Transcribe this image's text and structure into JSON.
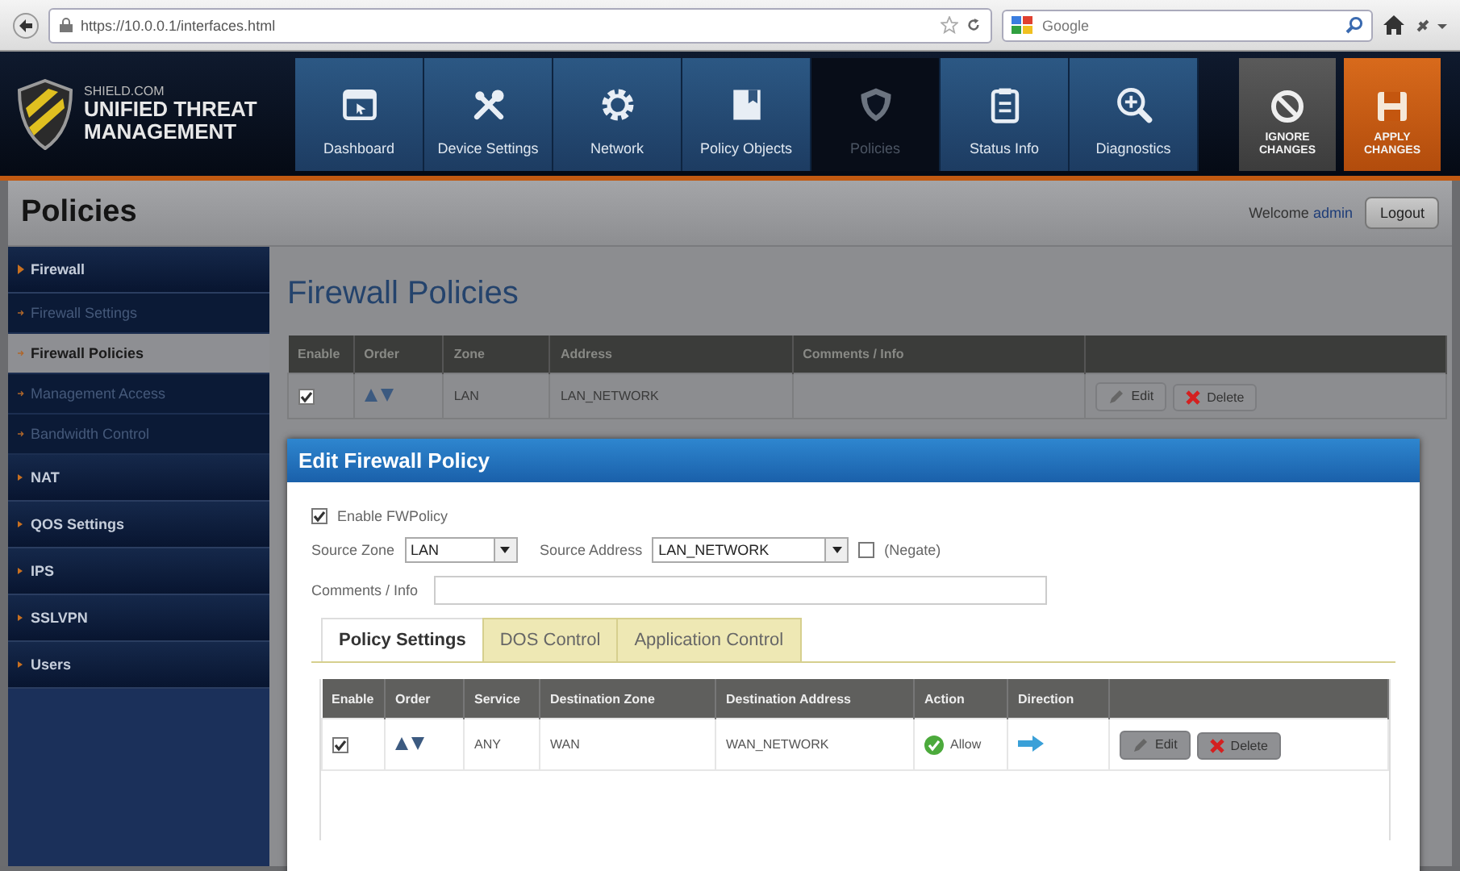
{
  "browser": {
    "url": "https://10.0.0.1/interfaces.html",
    "search": {
      "placeholder": "Google"
    }
  },
  "header": {
    "logo": {
      "top": "SHIELD.COM",
      "title": "UNIFIED THREAT MANAGEMENT"
    },
    "nav": [
      {
        "label": "Dashboard",
        "selected": false
      },
      {
        "label": "Device Settings",
        "selected": false
      },
      {
        "label": "Network",
        "selected": false
      },
      {
        "label": "Policy Objects",
        "selected": false
      },
      {
        "label": "Policies",
        "selected": true
      },
      {
        "label": "Status Info",
        "selected": false
      },
      {
        "label": "Diagnostics",
        "selected": false
      }
    ],
    "actions": [
      {
        "kind": "ignore",
        "label": "IGNORE CHANGES"
      },
      {
        "kind": "apply",
        "label": "APPLY CHANGES"
      }
    ]
  },
  "title_bar": {
    "title": "Policies",
    "welcome": "Welcome",
    "user": "admin",
    "logout": "Logout"
  },
  "sidebar": {
    "items": [
      {
        "label": "Firewall",
        "expanded": true,
        "children": [
          {
            "label": "Firewall Settings",
            "selected": false
          },
          {
            "label": "Firewall Policies",
            "selected": true
          },
          {
            "label": "Management Access",
            "selected": false
          },
          {
            "label": "Bandwidth Control",
            "selected": false
          }
        ]
      },
      {
        "label": "NAT",
        "expanded": false
      },
      {
        "label": "QOS Settings",
        "expanded": false
      },
      {
        "label": "IPS",
        "expanded": false
      },
      {
        "label": "SSLVPN",
        "expanded": false
      },
      {
        "label": "Users",
        "expanded": false
      }
    ]
  },
  "main": {
    "heading": "Firewall Policies",
    "table": {
      "columns": [
        "Enable",
        "Order",
        "Zone",
        "Address",
        "Comments / Info"
      ],
      "rows": [
        {
          "enabled": true,
          "zone": "LAN",
          "address": "LAN_NETWORK",
          "edit": "Edit",
          "delete": "Delete"
        }
      ]
    }
  },
  "dialog": {
    "title": "Edit Firewall Policy",
    "enable": {
      "label": "Enable FWPolicy",
      "checked": true
    },
    "source_zone": {
      "label": "Source Zone",
      "value": "LAN"
    },
    "source_address": {
      "label": "Source Address",
      "value": "LAN_NETWORK"
    },
    "negate": {
      "label": "(Negate)",
      "checked": false
    },
    "comments": {
      "label": "Comments / Info"
    },
    "tabs": [
      {
        "label": "Policy Settings",
        "selected": true
      },
      {
        "label": "DOS Control",
        "selected": false
      },
      {
        "label": "Application Control",
        "selected": false
      }
    ],
    "table": {
      "columns": [
        "Enable",
        "Order",
        "Service",
        "Destination Zone",
        "Destination Address",
        "Action",
        "Direction"
      ],
      "rows": [
        {
          "enabled": true,
          "service": "ANY",
          "zone": "WAN",
          "address": "WAN_NETWORK",
          "action": "Allow",
          "edit": "Edit",
          "delete": "Delete"
        }
      ]
    }
  }
}
